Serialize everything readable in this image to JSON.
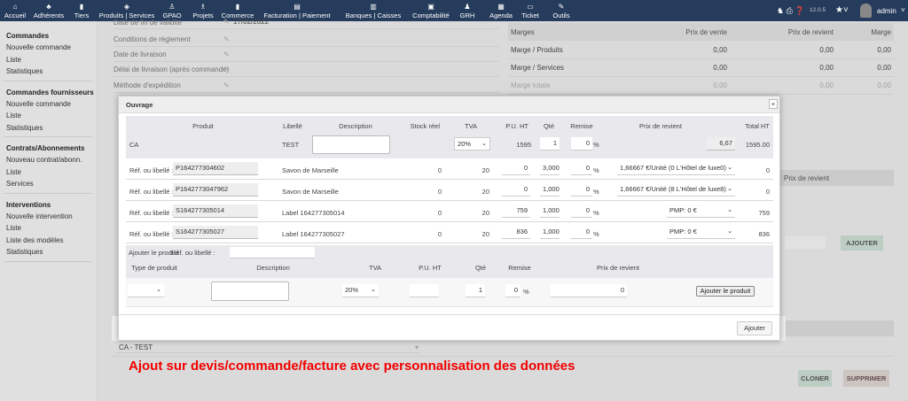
{
  "navbar": {
    "items": [
      {
        "label": "Accueil",
        "icon": "home-icon",
        "glyph": "⌂"
      },
      {
        "label": "Adhérents",
        "icon": "members-icon",
        "glyph": "♣"
      },
      {
        "label": "Tiers",
        "icon": "building-icon",
        "glyph": "▮"
      },
      {
        "label": "Produits | Services",
        "icon": "cube-icon",
        "glyph": "◈"
      },
      {
        "label": "GPAO",
        "icon": "cubes-icon",
        "glyph": "♙"
      },
      {
        "label": "Projets",
        "icon": "sitemap-icon",
        "glyph": "♗"
      },
      {
        "label": "Commerce",
        "icon": "suitcase-icon",
        "glyph": "▮"
      },
      {
        "label": "Facturation | Paiement",
        "icon": "invoice-icon",
        "glyph": "▤"
      },
      {
        "label": "Banques | Caisses",
        "icon": "bank-icon",
        "glyph": "▥"
      },
      {
        "label": "Comptabilité",
        "icon": "ledger-icon",
        "glyph": "▣"
      },
      {
        "label": "GRH",
        "icon": "user-tie-icon",
        "glyph": "♟"
      },
      {
        "label": "Agenda",
        "icon": "calendar-icon",
        "glyph": "▦"
      },
      {
        "label": "Ticket",
        "icon": "ticket-icon",
        "glyph": "▭"
      },
      {
        "label": "Outils",
        "icon": "wrench-icon",
        "glyph": "✎"
      }
    ],
    "version": "12.0.5",
    "user": "admin"
  },
  "sidebar": {
    "sections": [
      {
        "title": "Commandes",
        "items": [
          "Nouvelle commande",
          "Liste",
          "Statistiques"
        ]
      },
      {
        "title": "Commandes fournisseurs",
        "items": [
          "Nouvelle commande",
          "Liste",
          "Statistiques"
        ]
      },
      {
        "title": "Contrats/Abonnements",
        "items": [
          "Nouveau contrat/abonn.",
          "Liste",
          "Services"
        ]
      },
      {
        "title": "Interventions",
        "items": [
          "Nouvelle intervention",
          "Liste",
          "Liste des modèles",
          "Statistiques"
        ]
      }
    ]
  },
  "fields": [
    {
      "label": "Date de fin de validité",
      "value": "17/02/2022"
    },
    {
      "label": "Conditions de règlement",
      "value": ""
    },
    {
      "label": "Date de livraison",
      "value": ""
    },
    {
      "label": "Délai de livraison (après commande)",
      "value": ""
    },
    {
      "label": "Méthode d'expédition",
      "value": ""
    }
  ],
  "margins": {
    "headers": [
      "Marges",
      "Prix de vente",
      "Prix de revient",
      "Marge"
    ],
    "rows": [
      [
        "Marge / Produits",
        "0,00",
        "0,00",
        "0,00"
      ],
      [
        "Marge / Services",
        "0,00",
        "0,00",
        "0,00"
      ],
      [
        "Marge totale",
        "0,00",
        "0,00",
        "0,00"
      ]
    ]
  },
  "background": {
    "prix_header": "Prix de revient",
    "ajouter": "AJOUTER",
    "select_value": "CA - TEST",
    "cloner": "CLONER",
    "supprimer": "SUPPRIMER"
  },
  "caption": "Ajout sur devis/commande/facture avec personnalisation des données",
  "modal": {
    "title": "Ouvrage",
    "close": "×",
    "headers": {
      "produit": "Produit",
      "libelle": "Libellé",
      "description": "Description",
      "stock": "Stock réel",
      "tva": "TVA",
      "pu": "P.U. HT",
      "qte": "Qté",
      "remise": "Remise",
      "prix": "Prix de revient",
      "total": "Total HT"
    },
    "main": {
      "produit": "CA",
      "libelle": "TEST",
      "tva": "20%",
      "pu": "1595",
      "qte": "1",
      "remise": "0",
      "prix": "6,67",
      "total": "1595.00"
    },
    "ref_label": "Réf. ou libellé :",
    "lines": [
      {
        "ref": "P164277304602",
        "libelle": "Savon de Marseille",
        "stock": "0",
        "tva": "20",
        "pu": "0",
        "qte": "3,000",
        "remise": "0",
        "prix": "1,66667 €/Unité (0 L'Hôtel de luxe0)",
        "total": "0"
      },
      {
        "ref": "P1642773047962",
        "libelle": "Savon de Marseille",
        "stock": "0",
        "tva": "20",
        "pu": "0",
        "qte": "1,000",
        "remise": "0",
        "prix": "1,66667 €/Unité (8 L'Hôtel de luxe8)",
        "total": "0"
      },
      {
        "ref": "S164277305014",
        "libelle": "Label 164277305014",
        "stock": "0",
        "tva": "20",
        "pu": "759",
        "qte": "1,000",
        "remise": "0",
        "prix": "PMP: 0 €",
        "total": "759"
      },
      {
        "ref": "S164277305027",
        "libelle": "Label 164277305027",
        "stock": "0",
        "tva": "20",
        "pu": "836",
        "qte": "1,000",
        "remise": "0",
        "prix": "PMP: 0 €",
        "total": "836"
      }
    ],
    "add": {
      "title": "Ajouter le produit",
      "ref_label": "Réf. ou libellé :",
      "h_type": "Type de produit",
      "h_desc": "Description",
      "h_tva": "TVA",
      "h_pu": "P.U. HT",
      "h_qte": "Qté",
      "h_remise": "Remise",
      "h_prix": "Prix de revient",
      "tva": "20%",
      "qte": "1",
      "remise": "0",
      "prix": "0",
      "button": "Ajouter le produit"
    },
    "percent": "%",
    "submit": "Ajouter"
  }
}
